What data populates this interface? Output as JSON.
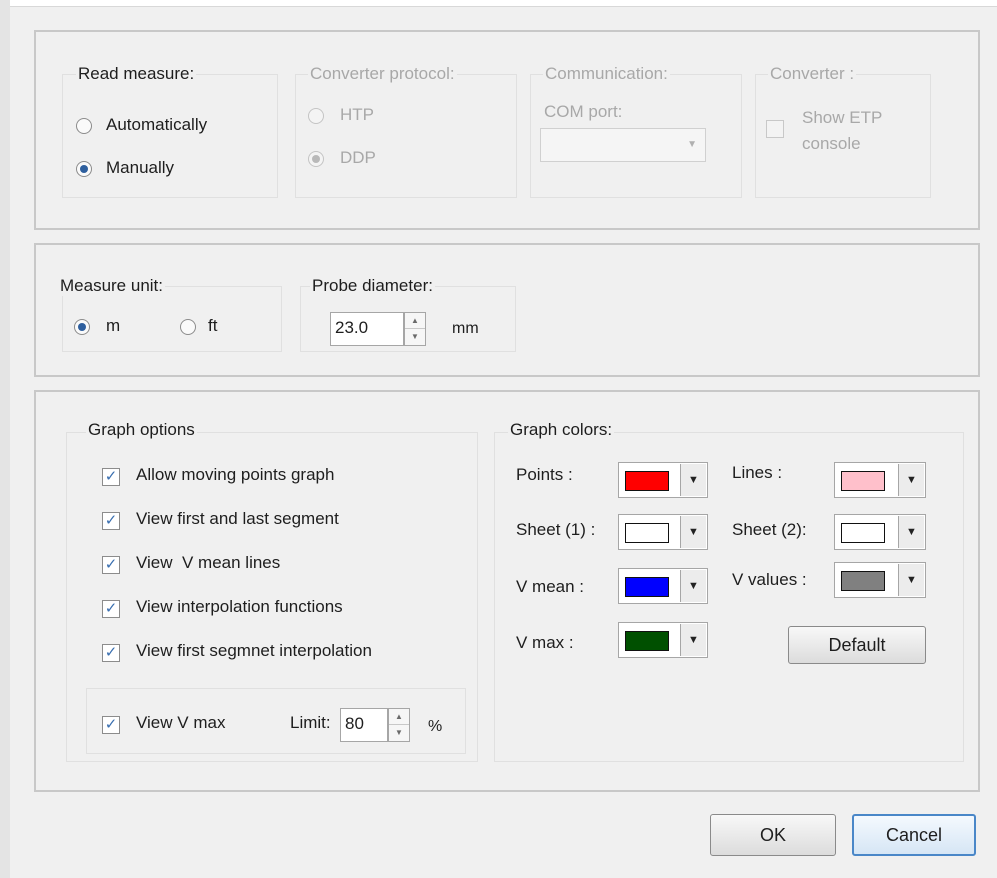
{
  "read_measure": {
    "legend": "Read measure:",
    "options": [
      "Automatically",
      "Manually"
    ],
    "selected": "Manually"
  },
  "converter_protocol": {
    "legend": "Converter protocol:",
    "options": [
      "HTP",
      "DDP"
    ],
    "selected": "DDP"
  },
  "communication": {
    "legend": "Communication:",
    "com_port_label": "COM port:",
    "com_port_value": ""
  },
  "converter": {
    "legend": "Converter :",
    "show_etp_line1": "Show ETP",
    "show_etp_line2": "console",
    "show_etp_checked": false
  },
  "measure_unit": {
    "legend": "Measure unit:",
    "options": [
      "m",
      "ft"
    ],
    "selected": "m"
  },
  "probe_diameter": {
    "legend": "Probe diameter:",
    "value": "23.0",
    "unit": "mm"
  },
  "graph_options": {
    "legend": "Graph options",
    "items": [
      {
        "label": "Allow moving points graph",
        "checked": true
      },
      {
        "label": "View first and last segment",
        "checked": true
      },
      {
        "label": "View  V mean lines",
        "checked": true
      },
      {
        "label": "View interpolation functions",
        "checked": true
      },
      {
        "label": "View first segmnet interpolation",
        "checked": true
      }
    ],
    "vmax_label": "View V max",
    "vmax_checked": true,
    "limit_label": "Limit:",
    "limit_value": "80",
    "limit_unit": "%"
  },
  "graph_colors": {
    "legend": "Graph colors:",
    "points_label": "Points :",
    "points_color": "#ff0000",
    "sheet1_label": "Sheet (1) :",
    "sheet1_color": "#ffffff",
    "vmean_label": "V mean :",
    "vmean_color": "#0000ff",
    "vmax_label": "V max :",
    "vmax_color": "#005000",
    "lines_label": "Lines :",
    "lines_color": "#ffc0cb",
    "sheet2_label": "Sheet (2):",
    "sheet2_color": "#ffffff",
    "vvalues_label": "V values :",
    "vvalues_color": "#808080",
    "default_button": "Default"
  },
  "buttons": {
    "ok": "OK",
    "cancel": "Cancel"
  },
  "icons": {
    "check": "checkmark-icon",
    "dropdown": "chevron-down-icon",
    "spin_up": "arrow-up-icon",
    "spin_down": "arrow-down-icon"
  }
}
